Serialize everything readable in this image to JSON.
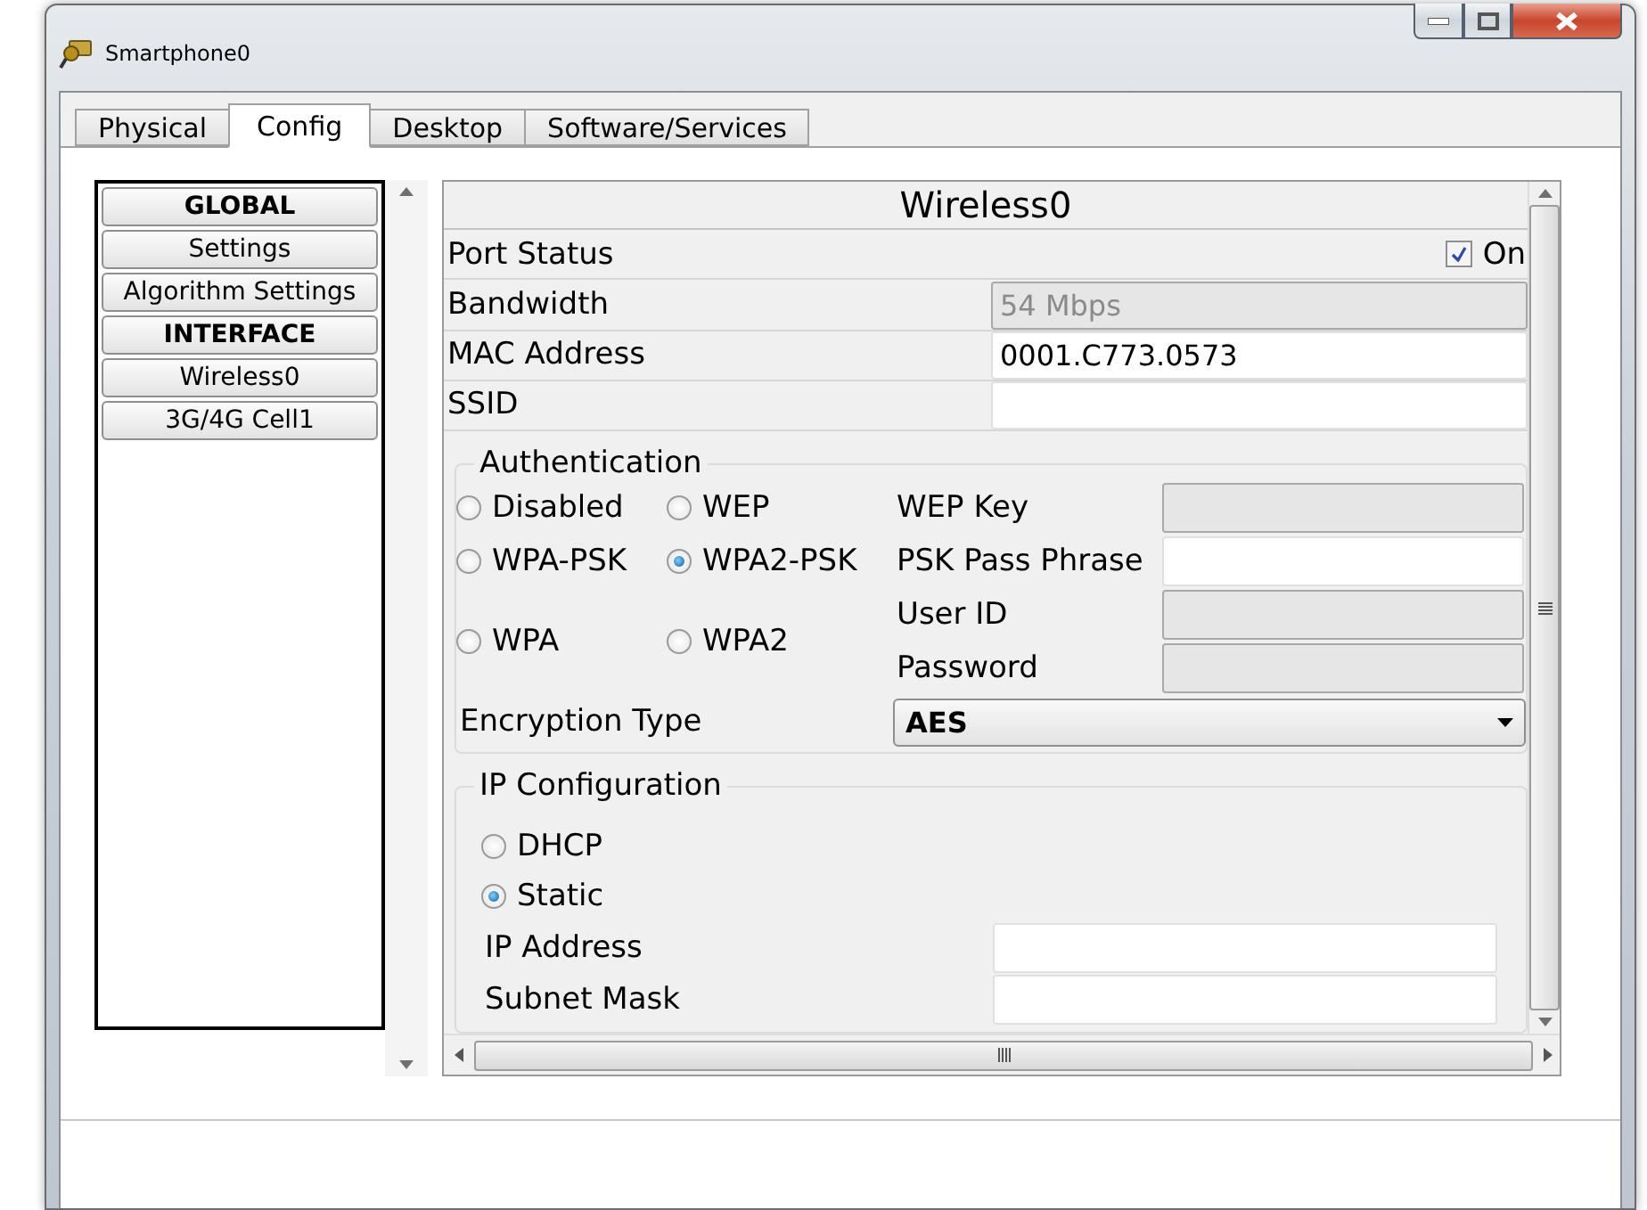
{
  "window": {
    "title": "Smartphone0"
  },
  "tabs": [
    {
      "label": "Physical",
      "selected": false
    },
    {
      "label": "Config",
      "selected": true
    },
    {
      "label": "Desktop",
      "selected": false
    },
    {
      "label": "Software/Services",
      "selected": false
    }
  ],
  "sidebar": {
    "items": [
      {
        "label": "GLOBAL",
        "kind": "header"
      },
      {
        "label": "Settings",
        "kind": "item"
      },
      {
        "label": "Algorithm Settings",
        "kind": "item"
      },
      {
        "label": "INTERFACE",
        "kind": "header"
      },
      {
        "label": "Wireless0",
        "kind": "item"
      },
      {
        "label": "3G/4G Cell1",
        "kind": "item"
      }
    ]
  },
  "panel": {
    "title": "Wireless0",
    "port_status": {
      "label": "Port Status",
      "checked": true,
      "checkbox_label": "On"
    },
    "fields": [
      {
        "label": "Bandwidth",
        "value": "54 Mbps",
        "disabled": true
      },
      {
        "label": "MAC Address",
        "value": "0001.C773.0573",
        "disabled": false
      },
      {
        "label": "SSID",
        "disabled": false
      }
    ],
    "authentication": {
      "title": "Authentication",
      "options": [
        {
          "label": "Disabled",
          "selected": false
        },
        {
          "label": "WEP",
          "selected": false
        },
        {
          "label": "WPA-PSK",
          "selected": false
        },
        {
          "label": "WPA2-PSK",
          "selected": true
        },
        {
          "label": "WPA",
          "selected": false
        },
        {
          "label": "WPA2",
          "selected": false
        }
      ],
      "fields": [
        {
          "label": "WEP Key",
          "disabled": true
        },
        {
          "label": "PSK Pass Phrase",
          "disabled": false
        },
        {
          "label": "User ID",
          "disabled": true
        },
        {
          "label": "Password",
          "disabled": true
        }
      ],
      "encryption": {
        "label": "Encryption Type",
        "value": "AES"
      }
    },
    "ip_configuration": {
      "title": "IP Configuration",
      "options": [
        {
          "label": "DHCP",
          "selected": false
        },
        {
          "label": "Static",
          "selected": true
        }
      ],
      "fields": [
        {
          "label": "IP Address",
          "disabled": false
        },
        {
          "label": "Subnet Mask",
          "disabled": false
        }
      ]
    }
  }
}
